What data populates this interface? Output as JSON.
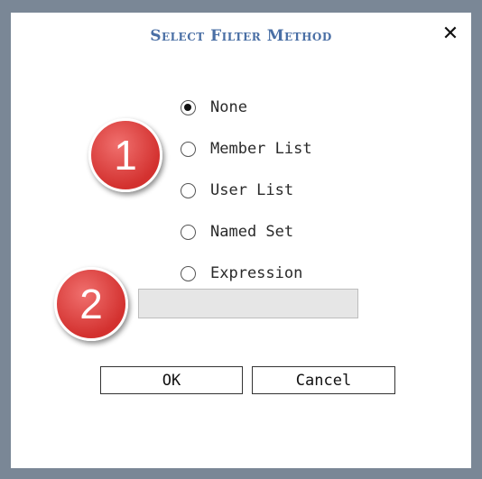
{
  "dialog": {
    "title": "Select Filter Method",
    "close_icon": "✕",
    "options": [
      {
        "label": "None",
        "checked": true
      },
      {
        "label": "Member List",
        "checked": false
      },
      {
        "label": "User List",
        "checked": false
      },
      {
        "label": "Named Set",
        "checked": false
      },
      {
        "label": "Expression",
        "checked": false
      }
    ],
    "expression_value": "",
    "ok_label": "OK",
    "cancel_label": "Cancel"
  },
  "annotations": {
    "badge1": "1",
    "badge2": "2",
    "badge_color": "#d3312f"
  },
  "colors": {
    "title": "#4a6fa5",
    "frame": "#7a8796"
  }
}
